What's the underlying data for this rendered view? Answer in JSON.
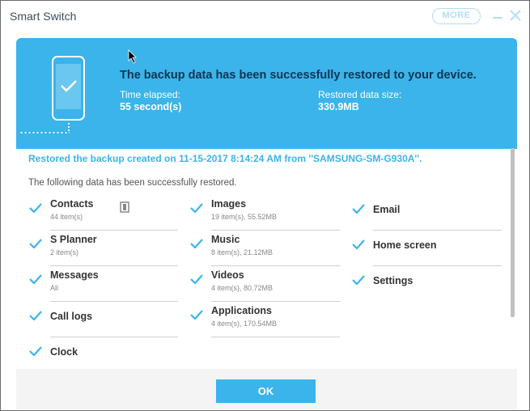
{
  "window": {
    "title": "Smart Switch",
    "more_label": "MORE"
  },
  "banner": {
    "headline": "The backup data has been successfully restored to your device.",
    "time_label": "Time elapsed:",
    "time_value": "55 second(s)",
    "size_label": "Restored data size:",
    "size_value": "330.9MB"
  },
  "content": {
    "restored_line": "Restored the backup created on 11-15-2017 8:14:24 AM from ''SAMSUNG-SM-G930A''.",
    "following_line": "The following data has been successfully restored."
  },
  "items": {
    "contacts": {
      "name": "Contacts",
      "sub": "44 item(s)"
    },
    "images": {
      "name": "Images",
      "sub": "19 item(s), 55.52MB"
    },
    "email": {
      "name": "Email",
      "sub": ""
    },
    "splanner": {
      "name": "S Planner",
      "sub": "2 item(s)"
    },
    "music": {
      "name": "Music",
      "sub": "8 item(s), 21.12MB"
    },
    "homescreen": {
      "name": "Home screen",
      "sub": ""
    },
    "messages": {
      "name": "Messages",
      "sub": "All"
    },
    "videos": {
      "name": "Videos",
      "sub": "4 item(s), 80.72MB"
    },
    "settings": {
      "name": "Settings",
      "sub": ""
    },
    "calllogs": {
      "name": "Call logs",
      "sub": ""
    },
    "applications": {
      "name": "Applications",
      "sub": "4 item(s), 170.54MB"
    },
    "clock": {
      "name": "Clock",
      "sub": ""
    }
  },
  "footer": {
    "ok_label": "OK"
  },
  "colors": {
    "accent": "#3ab4ea",
    "headline": "#0d3554"
  },
  "icons": [
    "phone-check-icon",
    "checkmark-icon",
    "device-icon",
    "close-icon",
    "minimize-icon",
    "cursor-icon"
  ]
}
